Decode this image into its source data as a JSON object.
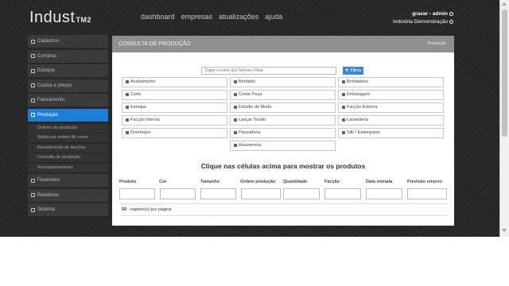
{
  "header": {
    "logo": "Indust",
    "logo_sub": "TM2",
    "nav": [
      "dashboard",
      "empresas",
      "atualizações",
      "ajuda"
    ],
    "user_name": "gravar - admin",
    "company": "Indústria Demonstração"
  },
  "sidebar": {
    "items": [
      {
        "label": "Cadastros"
      },
      {
        "label": "Compras"
      },
      {
        "label": "Estoque"
      },
      {
        "label": "Custos e preços"
      },
      {
        "label": "Faturamento"
      },
      {
        "label": "Produção"
      }
    ],
    "submenu": [
      "Ordens de produção",
      "Saída por ordem de cores",
      "Recebimento de facções",
      "Consulta de produção",
      "Acompanhamento"
    ],
    "items_after": [
      {
        "label": "Financeiro"
      },
      {
        "label": "Relatórios"
      },
      {
        "label": "Sistema"
      }
    ]
  },
  "page": {
    "title": "CONSULTA DE PRODUÇÃO",
    "breadcrumb": "Produção",
    "search_placeholder": "Digite o nome dos Setores Filtrar",
    "search_button": "Filtrar",
    "empty_message": "Clique nas células acima para mostrar os produtos",
    "per_page_count": "50",
    "per_page_label": "registro(s) por página"
  },
  "sectors": [
    "Acabamento",
    "Bordado",
    "Bordadeira",
    "Corte",
    "Cortar Peça",
    "Embalagem",
    "Estoque",
    "Estúdio de Moda",
    "Facção Externa",
    "Facção Interna",
    "Lançar Tecido",
    "Lavanderia",
    "Overloque",
    "Passadoria",
    "Silk / Estamparia",
    "Aviamentos"
  ],
  "table": {
    "columns": [
      "Produto",
      "Cor",
      "Tamanho",
      "Ordem produção",
      "Quantidade",
      "Facção",
      "Data entrada",
      "Previsão retorno"
    ]
  },
  "colors": {
    "accent": "#1c7ed6",
    "button": "#3a87d6",
    "panel_header": "#8f8f8f",
    "background": "#262626"
  }
}
